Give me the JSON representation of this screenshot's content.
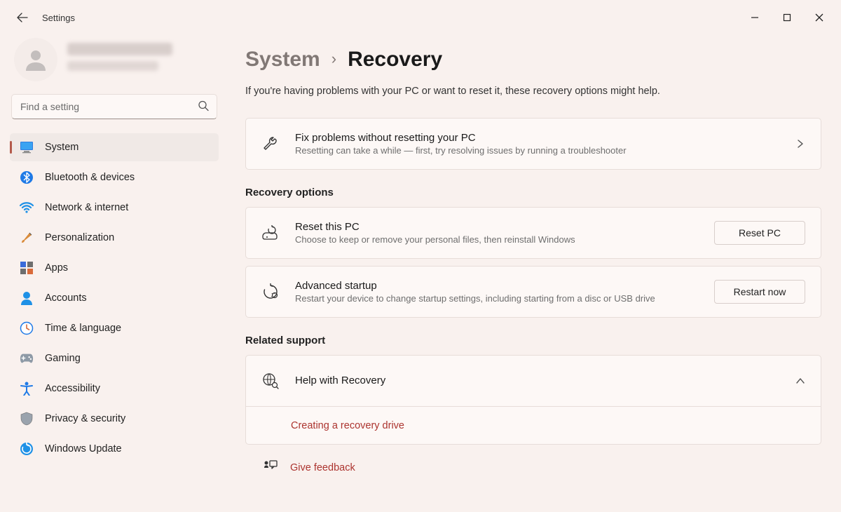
{
  "window": {
    "title": "Settings"
  },
  "search": {
    "placeholder": "Find a setting"
  },
  "nav": {
    "items": [
      {
        "label": "System"
      },
      {
        "label": "Bluetooth & devices"
      },
      {
        "label": "Network & internet"
      },
      {
        "label": "Personalization"
      },
      {
        "label": "Apps"
      },
      {
        "label": "Accounts"
      },
      {
        "label": "Time & language"
      },
      {
        "label": "Gaming"
      },
      {
        "label": "Accessibility"
      },
      {
        "label": "Privacy & security"
      },
      {
        "label": "Windows Update"
      }
    ]
  },
  "breadcrumb": {
    "parent": "System",
    "current": "Recovery"
  },
  "intro": "If you're having problems with your PC or want to reset it, these recovery options might help.",
  "cards": {
    "fix": {
      "title": "Fix problems without resetting your PC",
      "desc": "Resetting can take a while — first, try resolving issues by running a troubleshooter"
    },
    "reset": {
      "title": "Reset this PC",
      "desc": "Choose to keep or remove your personal files, then reinstall Windows",
      "button": "Reset PC"
    },
    "advanced": {
      "title": "Advanced startup",
      "desc": "Restart your device to change startup settings, including starting from a disc or USB drive",
      "button": "Restart now"
    },
    "help": {
      "title": "Help with Recovery",
      "link": "Creating a recovery drive"
    }
  },
  "sections": {
    "recovery": "Recovery options",
    "related": "Related support"
  },
  "feedback": {
    "label": "Give feedback"
  }
}
